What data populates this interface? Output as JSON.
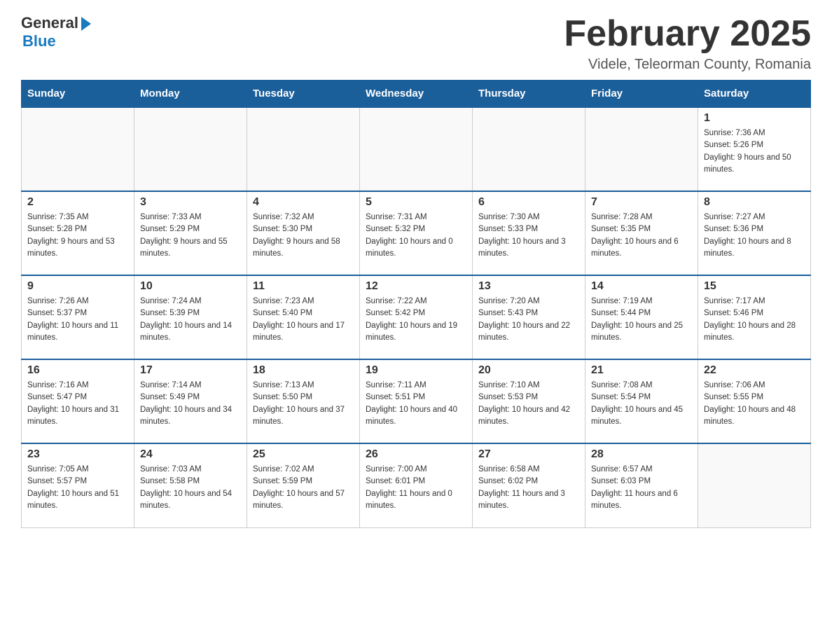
{
  "logo": {
    "general": "General",
    "blue": "Blue"
  },
  "title": "February 2025",
  "subtitle": "Videle, Teleorman County, Romania",
  "days_header": [
    "Sunday",
    "Monday",
    "Tuesday",
    "Wednesday",
    "Thursday",
    "Friday",
    "Saturday"
  ],
  "weeks": [
    [
      {
        "day": "",
        "info": ""
      },
      {
        "day": "",
        "info": ""
      },
      {
        "day": "",
        "info": ""
      },
      {
        "day": "",
        "info": ""
      },
      {
        "day": "",
        "info": ""
      },
      {
        "day": "",
        "info": ""
      },
      {
        "day": "1",
        "info": "Sunrise: 7:36 AM\nSunset: 5:26 PM\nDaylight: 9 hours and 50 minutes."
      }
    ],
    [
      {
        "day": "2",
        "info": "Sunrise: 7:35 AM\nSunset: 5:28 PM\nDaylight: 9 hours and 53 minutes."
      },
      {
        "day": "3",
        "info": "Sunrise: 7:33 AM\nSunset: 5:29 PM\nDaylight: 9 hours and 55 minutes."
      },
      {
        "day": "4",
        "info": "Sunrise: 7:32 AM\nSunset: 5:30 PM\nDaylight: 9 hours and 58 minutes."
      },
      {
        "day": "5",
        "info": "Sunrise: 7:31 AM\nSunset: 5:32 PM\nDaylight: 10 hours and 0 minutes."
      },
      {
        "day": "6",
        "info": "Sunrise: 7:30 AM\nSunset: 5:33 PM\nDaylight: 10 hours and 3 minutes."
      },
      {
        "day": "7",
        "info": "Sunrise: 7:28 AM\nSunset: 5:35 PM\nDaylight: 10 hours and 6 minutes."
      },
      {
        "day": "8",
        "info": "Sunrise: 7:27 AM\nSunset: 5:36 PM\nDaylight: 10 hours and 8 minutes."
      }
    ],
    [
      {
        "day": "9",
        "info": "Sunrise: 7:26 AM\nSunset: 5:37 PM\nDaylight: 10 hours and 11 minutes."
      },
      {
        "day": "10",
        "info": "Sunrise: 7:24 AM\nSunset: 5:39 PM\nDaylight: 10 hours and 14 minutes."
      },
      {
        "day": "11",
        "info": "Sunrise: 7:23 AM\nSunset: 5:40 PM\nDaylight: 10 hours and 17 minutes."
      },
      {
        "day": "12",
        "info": "Sunrise: 7:22 AM\nSunset: 5:42 PM\nDaylight: 10 hours and 19 minutes."
      },
      {
        "day": "13",
        "info": "Sunrise: 7:20 AM\nSunset: 5:43 PM\nDaylight: 10 hours and 22 minutes."
      },
      {
        "day": "14",
        "info": "Sunrise: 7:19 AM\nSunset: 5:44 PM\nDaylight: 10 hours and 25 minutes."
      },
      {
        "day": "15",
        "info": "Sunrise: 7:17 AM\nSunset: 5:46 PM\nDaylight: 10 hours and 28 minutes."
      }
    ],
    [
      {
        "day": "16",
        "info": "Sunrise: 7:16 AM\nSunset: 5:47 PM\nDaylight: 10 hours and 31 minutes."
      },
      {
        "day": "17",
        "info": "Sunrise: 7:14 AM\nSunset: 5:49 PM\nDaylight: 10 hours and 34 minutes."
      },
      {
        "day": "18",
        "info": "Sunrise: 7:13 AM\nSunset: 5:50 PM\nDaylight: 10 hours and 37 minutes."
      },
      {
        "day": "19",
        "info": "Sunrise: 7:11 AM\nSunset: 5:51 PM\nDaylight: 10 hours and 40 minutes."
      },
      {
        "day": "20",
        "info": "Sunrise: 7:10 AM\nSunset: 5:53 PM\nDaylight: 10 hours and 42 minutes."
      },
      {
        "day": "21",
        "info": "Sunrise: 7:08 AM\nSunset: 5:54 PM\nDaylight: 10 hours and 45 minutes."
      },
      {
        "day": "22",
        "info": "Sunrise: 7:06 AM\nSunset: 5:55 PM\nDaylight: 10 hours and 48 minutes."
      }
    ],
    [
      {
        "day": "23",
        "info": "Sunrise: 7:05 AM\nSunset: 5:57 PM\nDaylight: 10 hours and 51 minutes."
      },
      {
        "day": "24",
        "info": "Sunrise: 7:03 AM\nSunset: 5:58 PM\nDaylight: 10 hours and 54 minutes."
      },
      {
        "day": "25",
        "info": "Sunrise: 7:02 AM\nSunset: 5:59 PM\nDaylight: 10 hours and 57 minutes."
      },
      {
        "day": "26",
        "info": "Sunrise: 7:00 AM\nSunset: 6:01 PM\nDaylight: 11 hours and 0 minutes."
      },
      {
        "day": "27",
        "info": "Sunrise: 6:58 AM\nSunset: 6:02 PM\nDaylight: 11 hours and 3 minutes."
      },
      {
        "day": "28",
        "info": "Sunrise: 6:57 AM\nSunset: 6:03 PM\nDaylight: 11 hours and 6 minutes."
      },
      {
        "day": "",
        "info": ""
      }
    ]
  ]
}
